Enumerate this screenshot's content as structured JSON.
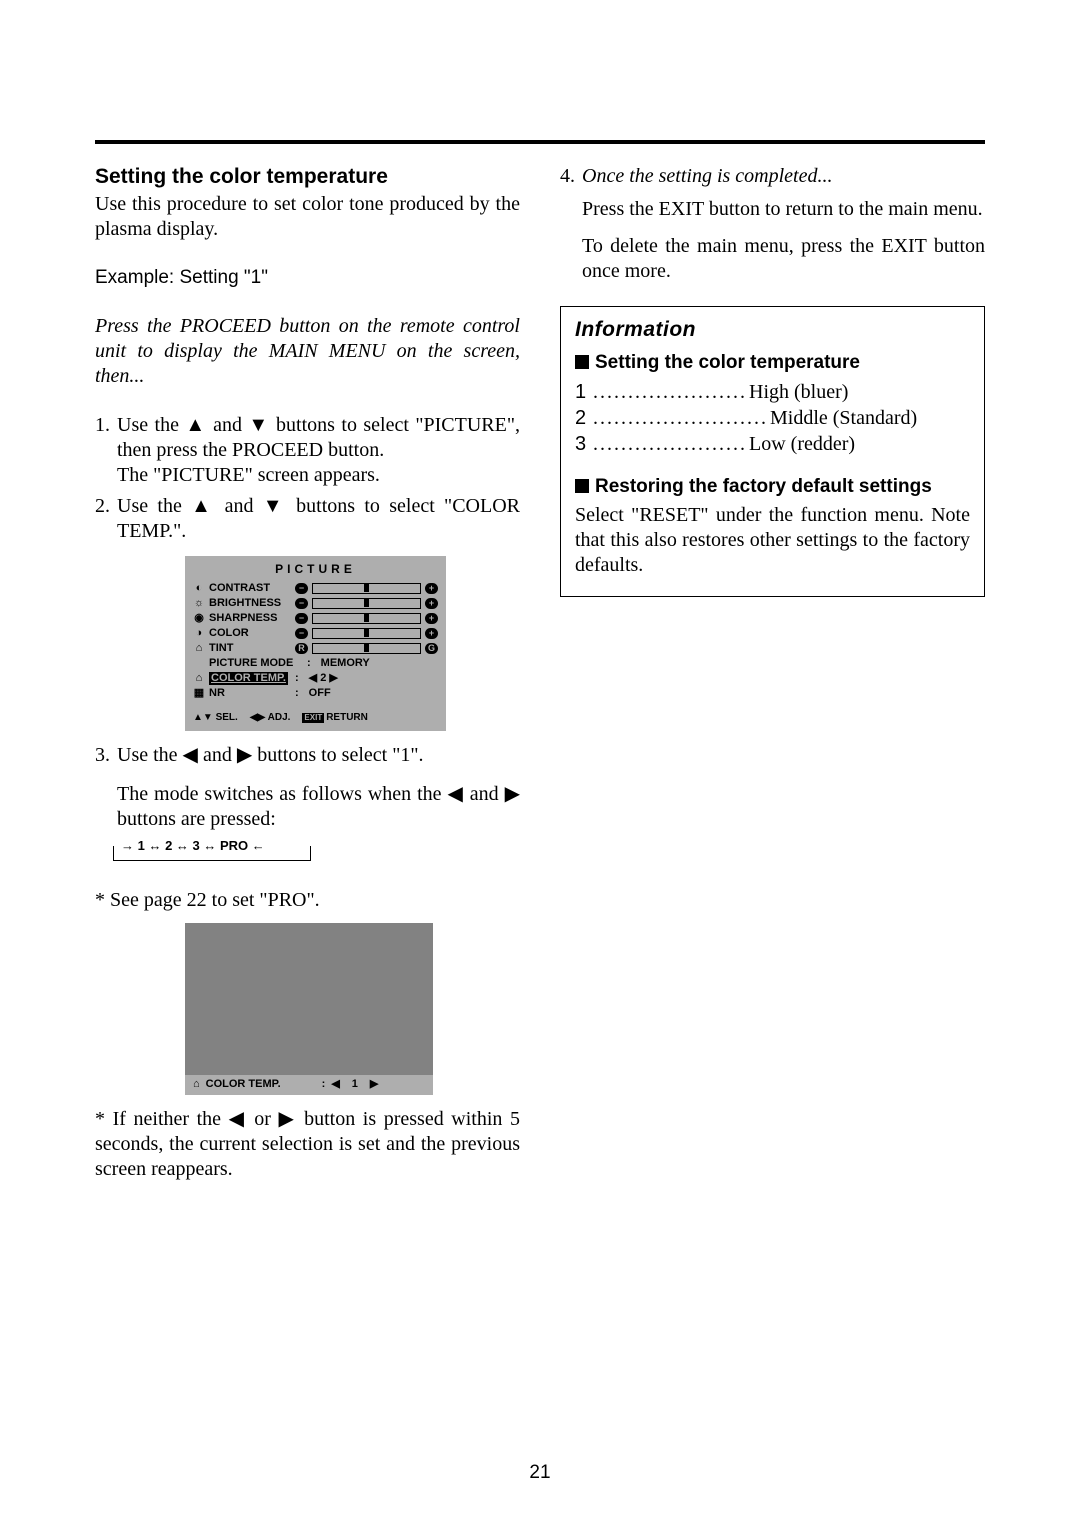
{
  "page_number": "21",
  "left": {
    "heading": "Setting the color temperature",
    "intro": "Use this procedure to set color tone produced by the plasma display.",
    "example": "Example: Setting \"1\"",
    "preamble": "Press the PROCEED button on the remote control unit to display the MAIN MENU on the screen, then...",
    "step1_a": "Use the ",
    "step1_b": " and ",
    "step1_c": " buttons to select \"PICTURE\", then press the PROCEED button.",
    "step1_d": "The \"PICTURE\" screen appears.",
    "step2_a": "Use the ",
    "step2_b": " and ",
    "step2_c": " buttons to select \"COLOR TEMP.\".",
    "step3_a": "Use the ",
    "step3_b": " and ",
    "step3_c": " buttons to select \"1\".",
    "step3_d": "The mode switches as follows when the ",
    "step3_e": " and ",
    "step3_f": " buttons are pressed:",
    "cycle": "→ 1 ↔ 2 ↔ 3 ↔ PRO ←",
    "see_pro": "* See page 22 to set \"PRO\".",
    "timeout": "* If neither the ",
    "timeout_mid": " or ",
    "timeout_end": " button is pressed within 5 seconds, the current selection is set and the previous screen reappears."
  },
  "osd": {
    "title": "PICTURE",
    "rows": [
      {
        "icon": "◐",
        "label": "CONTRAST",
        "left": "−",
        "right": "+"
      },
      {
        "icon": "☼",
        "label": "BRIGHTNESS",
        "left": "−",
        "right": "+"
      },
      {
        "icon": "◉",
        "label": "SHARPNESS",
        "left": "−",
        "right": "+"
      },
      {
        "icon": "◑",
        "label": "COLOR",
        "left": "−",
        "right": "+"
      },
      {
        "icon": "⌂",
        "label": "TINT",
        "left": "R",
        "right": "G"
      }
    ],
    "picture_mode_label": "PICTURE MODE",
    "picture_mode_value": "MEMORY",
    "color_temp_label": "COLOR TEMP.",
    "color_temp_value": "2",
    "nr_label": "NR",
    "nr_value": "OFF",
    "footer_sel": "SEL.",
    "footer_adj": "ADJ.",
    "footer_exit": "EXIT",
    "footer_return": "RETURN"
  },
  "preview": {
    "label": "COLOR TEMP.",
    "value": "1"
  },
  "right": {
    "step4_head": "Once the setting is completed...",
    "step4_a": "Press the EXIT button to return to the main menu.",
    "step4_b": "To delete the main menu, press the EXIT button once more.",
    "info_title": "Information",
    "sub1": "Setting the color temperature",
    "t1_num": "1",
    "t1_val": "High (bluer)",
    "t2_num": "2",
    "t2_val": "Middle (Standard)",
    "t3_num": "3",
    "t3_val": "Low (redder)",
    "sub2": "Restoring the factory default settings",
    "restore": "Select \"RESET\" under the function menu. Note that this also restores other settings to the factory defaults."
  }
}
